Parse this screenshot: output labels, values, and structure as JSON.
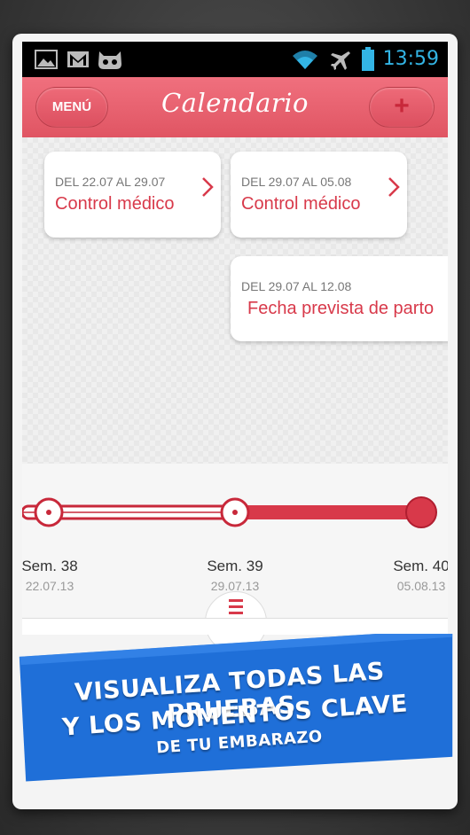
{
  "statusbar": {
    "time": "13:59",
    "left_icons": [
      "image-icon",
      "gmail-icon",
      "cyanogen-icon"
    ],
    "right_icons": [
      "wifi-icon",
      "airplane-icon",
      "battery-icon"
    ]
  },
  "appbar": {
    "menu_label": "MENÚ",
    "title": "Calendario",
    "add_label": "+"
  },
  "events": [
    {
      "date": "DEL 22.07 AL 29.07",
      "title": "Control médico"
    },
    {
      "date": "DEL 29.07 AL 05.08",
      "title": "Control médico"
    },
    {
      "date": "DEL 29.07 AL 12.08",
      "title": "Fecha prevista de parto"
    }
  ],
  "timeline": {
    "weeks": [
      {
        "label": "Sem. 38",
        "date": "22.07.13"
      },
      {
        "label": "Sem. 39",
        "date": "29.07.13"
      },
      {
        "label": "Sem. 40",
        "date": "05.08.13"
      }
    ]
  },
  "banner": {
    "line1": "VISUALIZA TODAS LAS PRUEBAS",
    "line2": "Y LOS MOMENTOS CLAVE",
    "line3": "DE TU EMBARAZO"
  },
  "colors": {
    "accent": "#e05563",
    "accent_dark": "#c8283a",
    "banner_blue": "#1f6fd8",
    "status_blue": "#33b5e5"
  }
}
